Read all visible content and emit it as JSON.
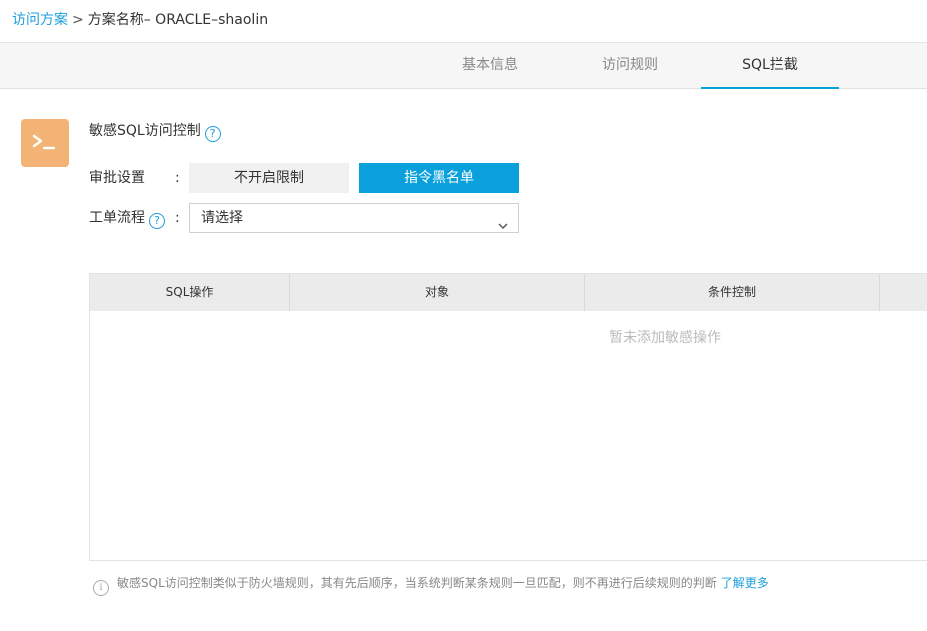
{
  "breadcrumb": {
    "root": "访问方案",
    "separator": ">",
    "current": "方案名称– ORACLE–shaolin"
  },
  "tabs": [
    {
      "label": "基本信息",
      "active": false
    },
    {
      "label": "访问规则",
      "active": false
    },
    {
      "label": "SQL拦截",
      "active": true
    }
  ],
  "section": {
    "icon": "terminal-icon",
    "title": "敏感SQL访问控制",
    "help": "?"
  },
  "approval": {
    "label": "审批设置",
    "colon": ":",
    "options": [
      "不开启限制",
      "指令黑名单"
    ],
    "selected": "指令黑名单"
  },
  "workflow": {
    "label": "工单流程",
    "help": "?",
    "colon": ":",
    "value": "请选择"
  },
  "table": {
    "columns": [
      "SQL操作",
      "对象",
      "条件控制"
    ],
    "empty_text": "暂未添加敏感操作"
  },
  "note": {
    "icon": "i",
    "text": "敏感SQL访问控制类似于防火墙规则，其有先后顺序，当系统判断某条规则一旦匹配，则不再进行后续规则的判断",
    "link": "了解更多"
  },
  "colors": {
    "accent": "#09a0db",
    "icon_bg": "#f3b374",
    "link": "#1c9ed9"
  }
}
